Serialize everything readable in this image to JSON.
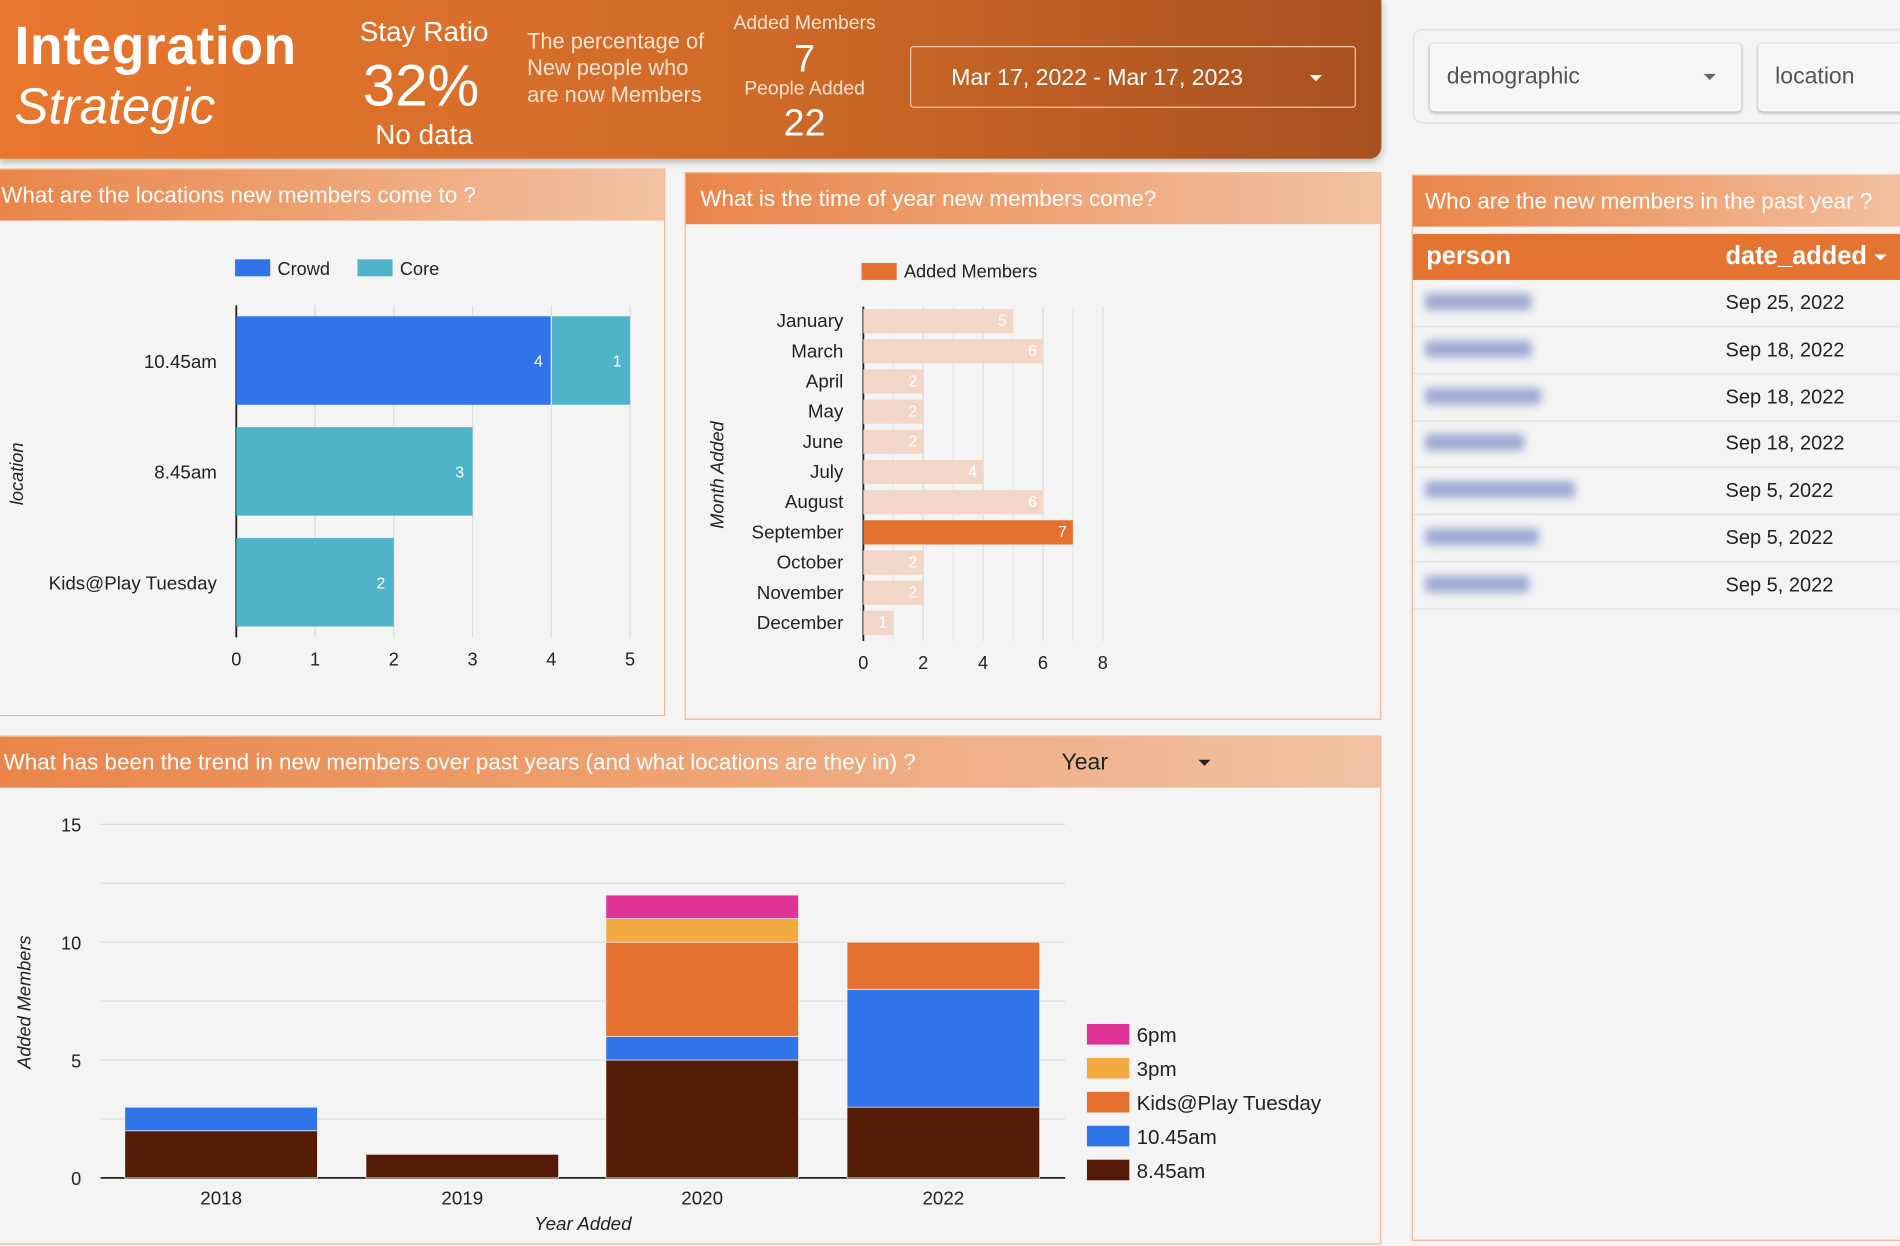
{
  "header": {
    "title": "Integration",
    "subtitle": "Strategic",
    "stay_ratio_label": "Stay Ratio",
    "stay_ratio_value": "32%",
    "stay_ratio_sub": "No data",
    "percentage_text": "The percentage of New people who are now Members",
    "added_members_label": "Added Members",
    "added_members_value": "7",
    "people_added_label": "People Added",
    "people_added_value": "22",
    "date_range": "Mar 17, 2022 - Mar 17, 2023"
  },
  "filters": [
    {
      "label": "demographic"
    },
    {
      "label": "location"
    }
  ],
  "panels": {
    "locations": {
      "title": "What are the locations new members come to ?"
    },
    "months": {
      "title": "What is the time of year new members come?"
    },
    "trend": {
      "title": "What has been the trend in new members over past years (and what locations are they in) ?",
      "dimension_select": "Year"
    },
    "people": {
      "title": "Who are the new members in the past year ?"
    }
  },
  "table": {
    "columns": [
      "person",
      "date_added"
    ],
    "sort": "date_added descending",
    "rows": [
      {
        "person": "Mark Baines",
        "date_added": "Sep 25, 2022"
      },
      {
        "person": "Lily Beeston",
        "date_added": "Sep 18, 2022"
      },
      {
        "person": "Rich Beeston",
        "date_added": "Sep 18, 2022"
      },
      {
        "person": "Ali Beeston",
        "date_added": "Sep 18, 2022"
      },
      {
        "person": "Vinayan Varghese",
        "date_added": "Sep 5, 2022"
      },
      {
        "person": "Vinoman Neal",
        "date_added": "Sep 5, 2022"
      },
      {
        "person": "Jasper Neal",
        "date_added": "Sep 5, 2022"
      }
    ]
  },
  "colors": {
    "brand_orange": "#e8772e",
    "crowd": "#3173e8",
    "core": "#4fb3c9",
    "month_bar": "#f2d7c8",
    "month_highlight": "#e4712f",
    "series_6pm": "#df3397",
    "series_3pm": "#f3ab41",
    "series_kids": "#e4712f",
    "series_1045": "#3173e8",
    "series_845": "#541c07"
  },
  "chart_data": [
    {
      "type": "bar",
      "orientation": "horizontal",
      "stacked": true,
      "categories": [
        "10.45am",
        "8.45am",
        "Kids@Play Tuesday"
      ],
      "series": [
        {
          "name": "Crowd",
          "values": [
            4,
            0,
            0
          ]
        },
        {
          "name": "Core",
          "values": [
            1,
            3,
            2
          ]
        }
      ],
      "ylabel": "location",
      "xlim": [
        0,
        5
      ],
      "xticks": [
        0,
        1,
        2,
        3,
        4,
        5
      ],
      "legend": "top",
      "grid": true
    },
    {
      "type": "bar",
      "orientation": "horizontal",
      "categories": [
        "January",
        "March",
        "April",
        "May",
        "June",
        "July",
        "August",
        "September",
        "October",
        "November",
        "December"
      ],
      "series": [
        {
          "name": "Added Members",
          "values": [
            5,
            6,
            2,
            2,
            2,
            4,
            6,
            7,
            2,
            2,
            1
          ]
        }
      ],
      "highlight": "September",
      "ylabel": "Month Added",
      "xlim": [
        0,
        8
      ],
      "xticks": [
        0,
        2,
        4,
        6,
        8
      ],
      "legend": "top",
      "grid": true
    },
    {
      "type": "bar",
      "stacked": true,
      "categories": [
        "2018",
        "2019",
        "2020",
        "2022"
      ],
      "series": [
        {
          "name": "8.45am",
          "values": [
            2,
            1,
            5,
            3
          ]
        },
        {
          "name": "10.45am",
          "values": [
            1,
            0,
            1,
            5
          ]
        },
        {
          "name": "Kids@Play Tuesday",
          "values": [
            0,
            0,
            4,
            2
          ]
        },
        {
          "name": "3pm",
          "values": [
            0,
            0,
            1,
            0
          ]
        },
        {
          "name": "6pm",
          "values": [
            0,
            0,
            1,
            0
          ]
        }
      ],
      "legend_order": [
        "6pm",
        "3pm",
        "Kids@Play Tuesday",
        "10.45am",
        "8.45am"
      ],
      "xlabel": "Year Added",
      "ylabel": "Added Members",
      "ylim": [
        0,
        15
      ],
      "yticks": [
        0,
        5,
        10,
        15
      ],
      "legend": "right",
      "grid": true
    }
  ]
}
